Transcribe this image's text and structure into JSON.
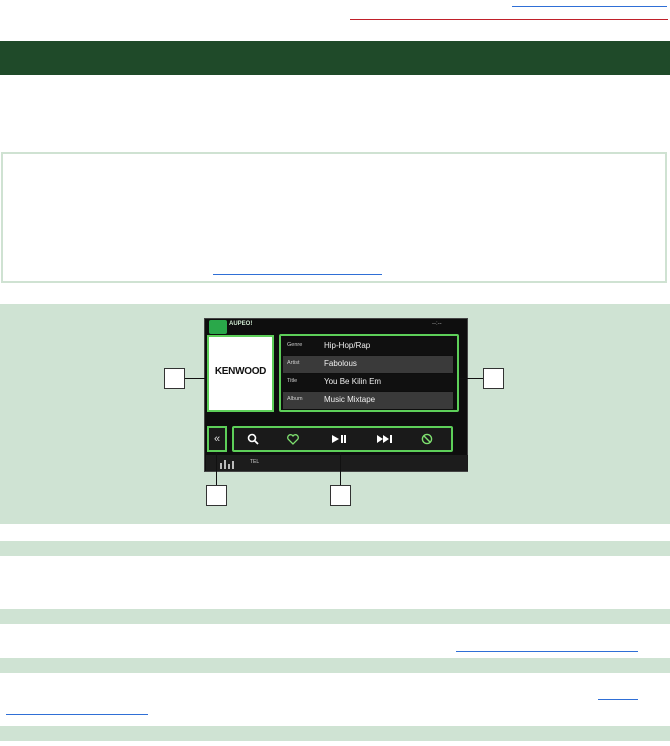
{
  "screen": {
    "source_label": "AUPEO!",
    "clock": "--:--",
    "album_art_text": "KENWOOD",
    "meta": [
      {
        "key": "Genre",
        "value": "Hip-Hop/Rap"
      },
      {
        "key": "Artist",
        "value": "Fabolous"
      },
      {
        "key": "Title",
        "value": "You Be Kilin Em"
      },
      {
        "key": "Album",
        "value": "Music Mixtape"
      }
    ],
    "controls": {
      "back": "«",
      "search": "🔍",
      "love": "♡",
      "play_pause": "►II",
      "next": "►►I",
      "ban": "⊘"
    },
    "bottom_tel": "TEL"
  },
  "colors": {
    "header_bar": "#1f4a29",
    "figure_bg": "#cfe3d3",
    "highlight": "#5dcf59",
    "link": "#2f6fd6",
    "rule_red": "#c0202a"
  }
}
